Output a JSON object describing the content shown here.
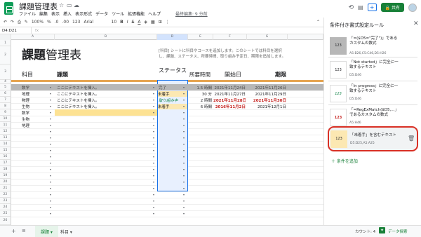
{
  "app": {
    "title": "課題管理表",
    "last_edit": "最終編集: 9 分前",
    "share": "共有",
    "menus": [
      "ファイル",
      "編集",
      "表示",
      "挿入",
      "表示形式",
      "データ",
      "ツール",
      "拡張機能",
      "ヘルプ"
    ]
  },
  "toolbar": {
    "zoom": "100%",
    "percent": "%",
    "dec0": ".0",
    "dec00": ".00",
    "fmt123": "123",
    "font": "Arial",
    "size": "10"
  },
  "formula": {
    "name_box": "D4:D21",
    "fx": "fx"
  },
  "columns": [
    "A",
    "B",
    "C",
    "D",
    "E",
    "F",
    "G"
  ],
  "rows": [
    "1",
    "2",
    "3",
    "4",
    "5",
    "6",
    "7",
    "8",
    "9",
    "10",
    "11",
    "12",
    "13",
    "14",
    "15",
    "16",
    "17",
    "18",
    "19",
    "20",
    "21",
    "22",
    "23",
    "24",
    "25",
    "26"
  ],
  "sheet": {
    "heading_a": "課題",
    "heading_b": "管理表",
    "note": "[科目] シートに科目やコースを追加します。このシートでは科目を選択し、課題、ステータス、所要時間、取り組み予定日、期限を追加します。",
    "headers": {
      "subject": "科目",
      "task": "課題",
      "status": "ステータス",
      "time": "所要時間",
      "start": "開始日",
      "due": "期限"
    },
    "data": [
      {
        "subject": "数学",
        "task": "ここにテキストを挿入。",
        "status": "完了",
        "time": "1.5 時間",
        "start": "2021年11月24日",
        "due": "2021年11月26日"
      },
      {
        "subject": "地理",
        "task": "ここにテキストを挿入。",
        "status": "未着手",
        "time": "30 分",
        "start": "2021年11月27日",
        "due": "2021年11月29日"
      },
      {
        "subject": "物理",
        "task": "ここにテキストを挿入。",
        "status": "取り組み中",
        "time": "2 時間",
        "start": "2021年11月28日",
        "due": "2021年11月30日"
      },
      {
        "subject": "生物",
        "task": "ここにテキストを挿入。",
        "status": "未着手",
        "time": "6 時間",
        "start": "2016年11月2日",
        "due": "2021年12月1日"
      },
      {
        "subject": "数学",
        "task": "",
        "status": "",
        "time": "",
        "start": "",
        "due": ""
      },
      {
        "subject": "生物",
        "task": "",
        "status": "",
        "time": "",
        "start": "",
        "due": ""
      },
      {
        "subject": "地理",
        "task": "",
        "status": "",
        "time": "",
        "start": "",
        "due": ""
      }
    ]
  },
  "panel": {
    "title": "条件付き書式設定ルール",
    "rules": [
      {
        "swatch": "123",
        "text": "「=($D5=\"完了\")」であるカスタムの数式",
        "range": "A5:B26,C5:C46,D5:H26"
      },
      {
        "swatch": "123",
        "text": "「Not started」に完全に一致するテキスト",
        "range": "D5:D46"
      },
      {
        "swatch": "123",
        "text": "「In progress」に完全に一致するテキスト",
        "range": "D5:D46"
      },
      {
        "swatch": "123",
        "text": "「=RegExMatch($D5,...」であるカスタムの数式",
        "range": "A5:H46"
      },
      {
        "swatch": "123",
        "text": "「未着手」を含むテキスト",
        "range": "D5:D25,A5:A25"
      }
    ],
    "add_rule": "条件を追加"
  },
  "tabs": {
    "active": "課題",
    "other": "科目",
    "count": "カウント: 4",
    "explore": "データ探索"
  }
}
